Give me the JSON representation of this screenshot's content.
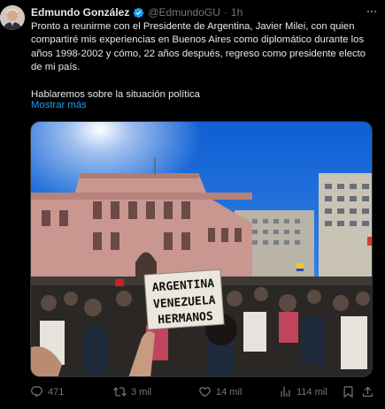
{
  "tweet": {
    "author_name": "Edmundo González",
    "author_handle": "@EdmundoGU",
    "separator": "·",
    "time": "1h",
    "text_line_1": "Pronto a reunirme con el Presidente de Argentina, Javier Milei, con quien compartiré mis experiencias en Buenos Aires como diplomático durante los años 1998-2002 y cómo, 22 años después, regreso como presidente electo de mi país.",
    "text_line_2": "Hablaremos sobre la situación política",
    "show_more": "Mostrar más"
  },
  "photo": {
    "sign_line_1": "ARGENTINA",
    "sign_line_2": "VENEZUELA",
    "sign_line_3": "HERMANOS"
  },
  "actions": {
    "replies": "471",
    "reposts": "3 mil",
    "likes": "14 mil",
    "views": "114 mil"
  },
  "colors": {
    "background": "#000000",
    "text": "#e7e9ea",
    "muted": "#71767b",
    "link": "#1d9bf0"
  }
}
